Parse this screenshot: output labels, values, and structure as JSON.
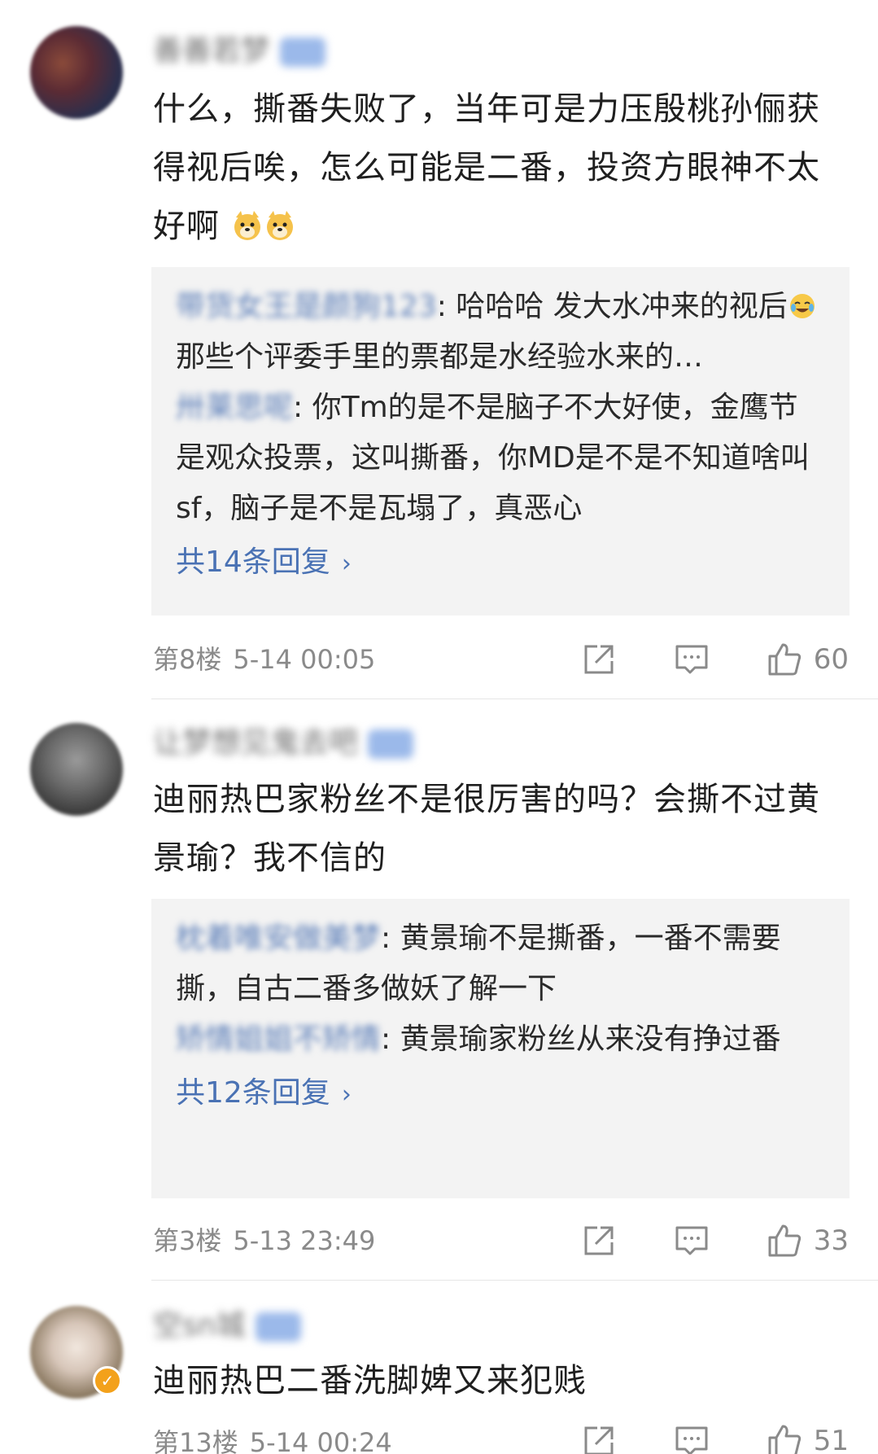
{
  "comments": [
    {
      "username": "善善若梦",
      "content": "什么，撕番失败了，当年可是力压殷桃孙俪获得视后唉，怎么可能是二番，投资方眼神不太好啊",
      "emoji": [
        "doge-emoji",
        "doge-emoji"
      ],
      "replies": [
        {
          "user": "带货女王是颜狗123",
          "text": "哈哈哈  发大水冲来的视后",
          "tail": "那些个评委手里的票都是水经验水来的…"
        },
        {
          "user": "卅莱思呢",
          "text": "你Tm的是不是脑子不大好使，金鹰节是观众投票，这叫撕番，你MD是不是不知道啥叫sf，脑子是不是瓦塌了，真恶心"
        }
      ],
      "more_replies": "共14条回复",
      "floor": "第8楼",
      "time": "5-14 00:05",
      "likes": "60"
    },
    {
      "username": "让梦想见鬼去吧",
      "content": "迪丽热巴家粉丝不是很厉害的吗？会撕不过黄景瑜？我不信的",
      "replies": [
        {
          "user": "枕着唯安做美梦",
          "text": "黄景瑜不是撕番，一番不需要撕，自古二番多做妖了解一下"
        },
        {
          "user": "矫情姐姐不矫情",
          "text": "黄景瑜家粉丝从来没有挣过番"
        }
      ],
      "more_replies": "共12条回复",
      "floor": "第3楼",
      "time": "5-13 23:49",
      "likes": "33"
    },
    {
      "username": "空sn城",
      "content": "迪丽热巴二番洗脚婢又来犯贱",
      "floor": "第13楼",
      "time": "5-14 00:24",
      "likes": "51"
    }
  ],
  "colors": {
    "link": "#4a72b4",
    "meta": "#8a8a8a",
    "reply_bg": "#f3f3f3",
    "verified": "#f3a11b"
  }
}
